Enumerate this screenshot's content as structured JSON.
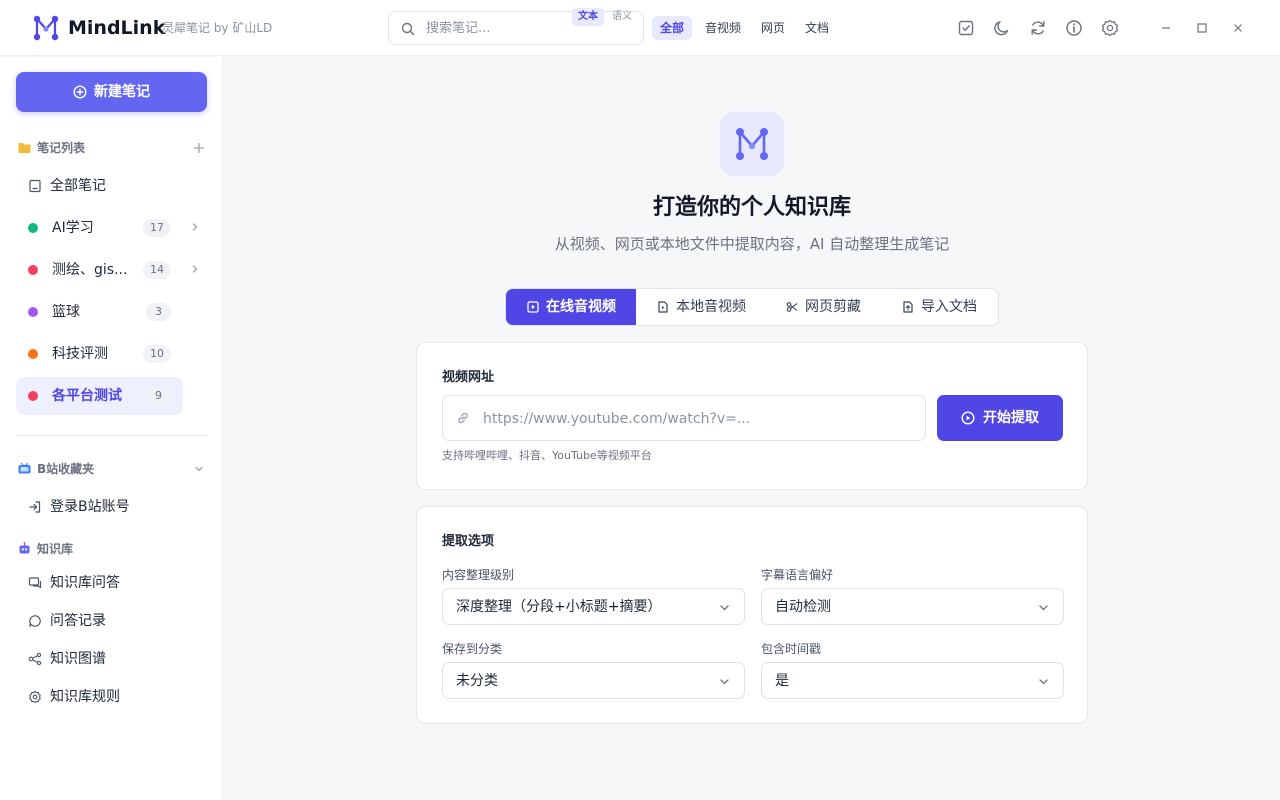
{
  "app": {
    "name": "MindLink",
    "subtitle": "灵犀笔记 by 矿山LD",
    "accent_color": "#4f46e5",
    "logo_icon": "m-network-logo"
  },
  "search": {
    "placeholder": "搜索笔记...",
    "modes": [
      "文本",
      "语义"
    ],
    "active_mode": "文本"
  },
  "filters": {
    "items": [
      "全部",
      "音视频",
      "网页",
      "文档"
    ],
    "active": "全部"
  },
  "toolbar_icons": [
    "checklist-icon",
    "moon-icon",
    "refresh-icon",
    "info-icon",
    "settings-icon"
  ],
  "window_controls": [
    "minimize-icon",
    "maximize-icon",
    "close-icon"
  ],
  "sidebar": {
    "new_note_label": "新建笔记",
    "notes_section": {
      "title": "笔记列表",
      "all_notes": "全部笔记",
      "categories": [
        {
          "label": "AI学习",
          "count": "17",
          "color": "#10b981",
          "expandable": true,
          "active": false
        },
        {
          "label": "测绘、gis...",
          "count": "14",
          "color": "#f43f5e",
          "expandable": true,
          "active": false
        },
        {
          "label": "篮球",
          "count": "3",
          "color": "#a855f7",
          "expandable": false,
          "active": false
        },
        {
          "label": "科技评测",
          "count": "10",
          "color": "#f97316",
          "expandable": false,
          "active": false
        },
        {
          "label": "各平台测试",
          "count": "9",
          "color": "#f43f5e",
          "expandable": false,
          "active": true
        }
      ]
    },
    "bilibili_section": {
      "title": "B站收藏夹",
      "login": "登录B站账号"
    },
    "kb_section": {
      "title": "知识库",
      "items": [
        "知识库问答",
        "问答记录",
        "知识图谱",
        "知识库规则"
      ]
    }
  },
  "main": {
    "hero_title": "打造你的个人知识库",
    "hero_subtitle": "从视频、网页或本地文件中提取内容，AI 自动整理生成笔记",
    "tabs": [
      "在线音视频",
      "本地音视频",
      "网页剪藏",
      "导入文档"
    ],
    "active_tab": "在线音视频",
    "url_card": {
      "label": "视频网址",
      "placeholder": "https://www.youtube.com/watch?v=...",
      "button": "开始提取",
      "hint": "支持哔哩哔哩、抖音、YouTube等视频平台"
    },
    "options_card": {
      "title": "提取选项",
      "fields": [
        {
          "label": "内容整理级别",
          "value": "深度整理（分段+小标题+摘要）"
        },
        {
          "label": "字幕语言偏好",
          "value": "自动检测"
        },
        {
          "label": "保存到分类",
          "value": "未分类"
        },
        {
          "label": "包含时间戳",
          "value": "是"
        }
      ]
    }
  }
}
